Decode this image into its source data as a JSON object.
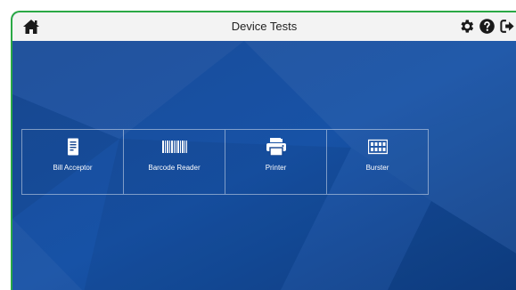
{
  "header": {
    "title": "Device Tests",
    "left_icon": "home-icon",
    "right_icons": [
      "settings-gear-icon",
      "help-icon",
      "logout-icon"
    ]
  },
  "tiles": [
    {
      "label": "Bill Acceptor",
      "icon": "bill-acceptor-icon"
    },
    {
      "label": "Barcode Reader",
      "icon": "barcode-icon"
    },
    {
      "label": "Printer",
      "icon": "printer-icon"
    },
    {
      "label": "Burster",
      "icon": "burster-icon"
    }
  ],
  "colors": {
    "frame_border": "#2aa845",
    "background": "#15458f",
    "topbar": "#f3f3f3"
  }
}
